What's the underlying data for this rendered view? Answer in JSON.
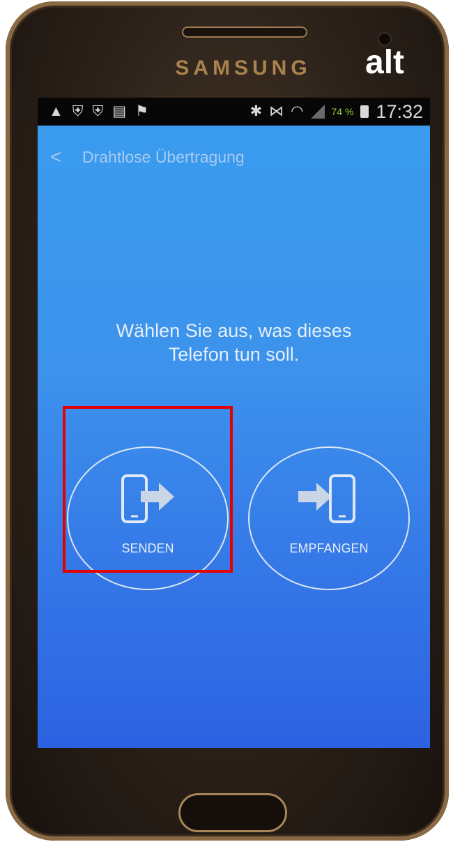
{
  "device": {
    "brand": "SAMSUNG",
    "overlay_label": "alt"
  },
  "statusbar": {
    "left_icons": [
      "warning-icon",
      "shield-icon",
      "shield-icon",
      "document-icon",
      "flag-icon"
    ],
    "right_icons": [
      "bluetooth-icon",
      "mute-icon",
      "wifi-icon",
      "signal-icon"
    ],
    "battery": "74 %",
    "time": "17:32"
  },
  "appbar": {
    "back": "<",
    "title": "Drahtlose Übertragung"
  },
  "main": {
    "prompt_line1": "Wählen Sie aus, was dieses",
    "prompt_line2": "Telefon tun soll.",
    "send_label": "SENDEN",
    "receive_label": "EMPFANGEN"
  },
  "colors": {
    "highlight": "#e50000",
    "screen_top": "#3a9bed",
    "screen_bottom": "#2c62e2"
  }
}
